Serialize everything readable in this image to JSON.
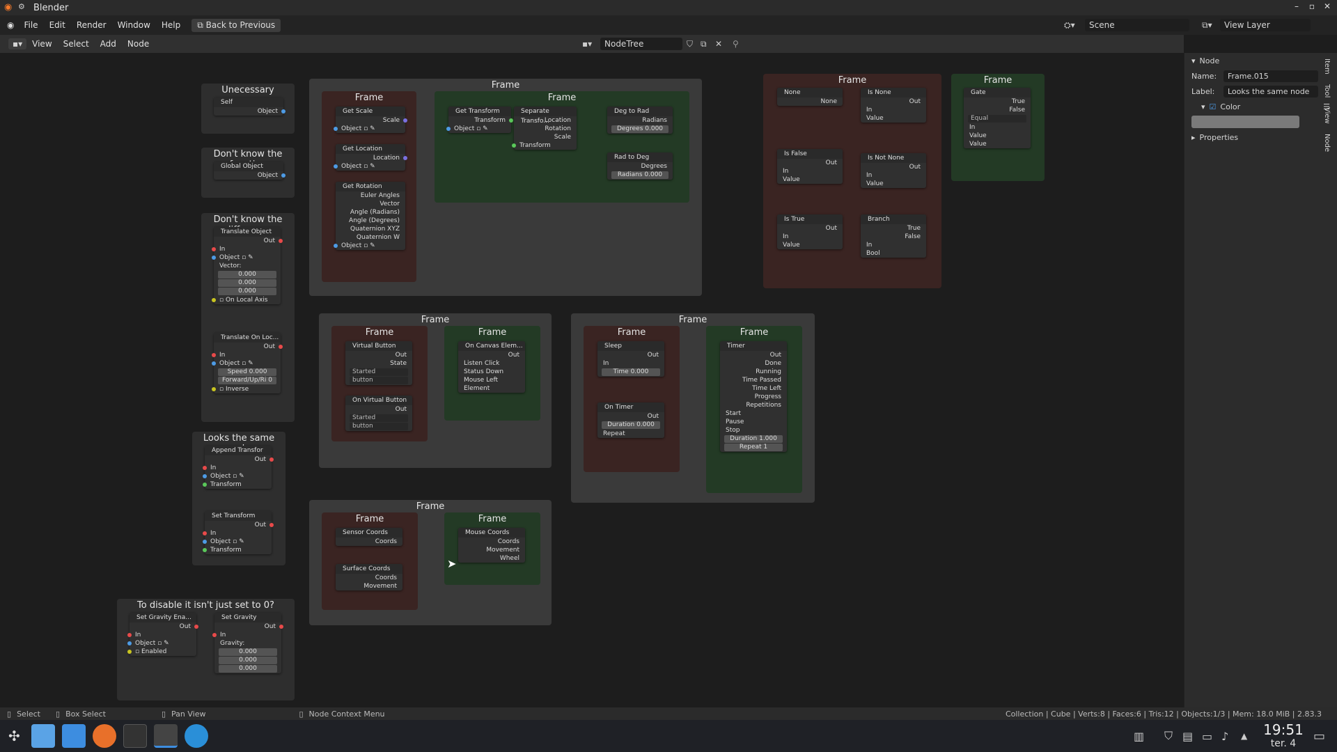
{
  "window": {
    "title": "Blender",
    "min": "–",
    "max": "▫",
    "close": "✕"
  },
  "menu": {
    "items": [
      "File",
      "Edit",
      "Render",
      "Window",
      "Help"
    ],
    "back": "Back to Previous",
    "scene": "Scene",
    "view_layer": "View Layer"
  },
  "editor": {
    "items": [
      "View",
      "Select",
      "Add",
      "Node"
    ],
    "tree": "NodeTree"
  },
  "frames": {
    "f1": "Frame",
    "f2": "Frame",
    "f3": "Frame",
    "f4": "Frame",
    "f5": "Frame",
    "f6": "Frame",
    "f7": "Frame",
    "f8": "Frame",
    "f9": "Frame",
    "f10": "Frame",
    "f11": "Frame",
    "f12": "Frame",
    "f13": "Frame",
    "f14": "Frame",
    "f15": "Frame"
  },
  "notes": {
    "unnecessary": "Unecessary",
    "dont_fn": "Don't know the function",
    "dont_diff": "Don't know the difference",
    "same": "Looks the same node",
    "disable": "To disable it isn't just set to 0?"
  },
  "sidebar": {
    "panel": "Node",
    "name_lbl": "Name:",
    "name_val": "Frame.015",
    "label_lbl": "Label:",
    "label_val": "Looks the same node",
    "color": "Color",
    "properties": "Properties",
    "tabs": [
      "Item",
      "Tool",
      "View",
      "Node"
    ]
  },
  "status": {
    "select": "Select",
    "box": "Box Select",
    "pan": "Pan View",
    "ctx": "Node Context Menu",
    "info": "Collection | Cube | Verts:8 | Faces:6 | Tris:12 | Objects:1/3 | Mem: 18.0 MiB | 2.83.3"
  },
  "clock": {
    "time": "19:51",
    "date": "ter. 4"
  },
  "n": {
    "self": "Self",
    "object": "Object",
    "global_obj": "Global Object",
    "translate": "Translate Object",
    "out": "Out",
    "in": "In",
    "vector": "Vector:",
    "v0": "0.000",
    "local": "On Local Axis",
    "tolo": "Translate On Loc...",
    "speed": "Speed",
    "speed_v": "0.000",
    "fur": "Forward/Up/Ri 0",
    "inverse": "Inverse",
    "append": "Append Transfor",
    "transform": "Transform",
    "set_tr": "Set Transform",
    "grav_en": "Set Gravity Ena...",
    "set_grav": "Set Gravity",
    "enabled": "Enabled",
    "gravity": "Gravity:",
    "get_scale": "Get Scale",
    "scale": "Scale",
    "get_loc": "Get Location",
    "location": "Location",
    "get_rot": "Get Rotation",
    "euler": "Euler Angles",
    "vec": "Vector",
    "ang_rad": "Angle (Radians)",
    "ang_deg": "Angle (Degrees)",
    "qxyz": "Quaternion XYZ",
    "qw": "Quaternion W",
    "get_tr": "Get Transform",
    "sep_tr": "Separate Transfo...",
    "rotation": "Rotation",
    "deg2rad": "Deg to Rad",
    "radians": "Radians",
    "degrees": "Degrees",
    "deg_v": "Degrees   0.000",
    "rad2deg": "Rad to Deg",
    "rad_v": "Radians   0.000",
    "none": "None",
    "is_none": "Is None",
    "value": "Value",
    "is_false": "Is False",
    "is_not_none": "Is Not None",
    "is_true": "Is True",
    "branch": "Branch",
    "true": "True",
    "false": "False",
    "bool": "Bool",
    "gate": "Gate",
    "equal": "Equal",
    "vbtn": "Virtual Button",
    "state": "State",
    "started": "Started",
    "button": "button",
    "on_vbtn": "On Virtual Button",
    "on_canvas": "On Canvas Elem...",
    "listen": "Listen",
    "click": "Click",
    "status": "Status",
    "down": "Down",
    "mouse": "Mouse",
    "left": "Left",
    "element": "Element",
    "sleep": "Sleep",
    "time": "Time",
    "time_v": "0.000",
    "on_timer": "On Timer",
    "duration": "Duration",
    "dur_v": "0.000",
    "repeat": "Repeat",
    "timer": "Timer",
    "done": "Done",
    "running": "Running",
    "time_passed": "Time Passed",
    "time_left": "Time Left",
    "progress": "Progress",
    "repetitions": "Repetitions",
    "start": "Start",
    "pause": "Pause",
    "stop": "Stop",
    "dur_t": "Duration  1.000",
    "rep_t": "Repeat       1",
    "sensor": "Sensor Coords",
    "coords": "Coords",
    "surface": "Surface Coords",
    "movement": "Movement",
    "mouse_c": "Mouse Coords",
    "wheel": "Wheel"
  }
}
